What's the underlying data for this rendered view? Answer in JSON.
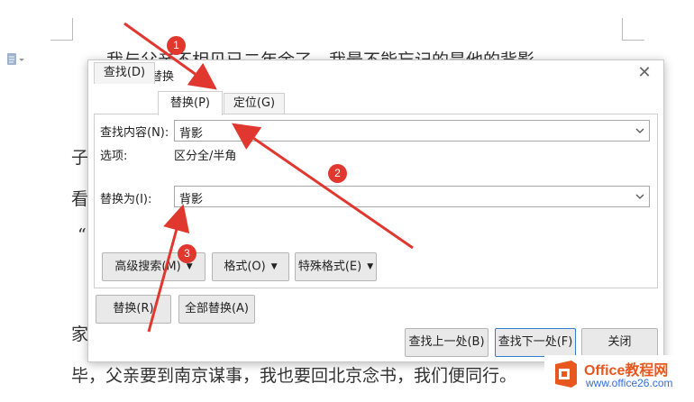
{
  "document": {
    "lines": [
      "我与父亲不相见已二年余了，我最不能忘记的是他的背影。",
      "子",
      "看",
      "“",
      "家",
      "毕，父亲要到南京谋事，我也要回北京念书，我们便同行。"
    ]
  },
  "dialog": {
    "title": "查找和替换",
    "tabs": [
      "查找(D)",
      "替换(P)",
      "定位(G)"
    ],
    "active_tab": "替换(P)",
    "find_label": "查找内容(N):",
    "find_value": "背影",
    "options_label": "选项:",
    "options_value": "区分全/半角",
    "replace_label": "替换为(I):",
    "replace_value": "背影",
    "advanced_search": "高级搜索(M)",
    "format": "格式(O)",
    "special_format": "特殊格式(E)",
    "replace_btn": "替换(R)",
    "replace_all_btn": "全部替换(A)",
    "find_prev_btn": "查找上一处(B)",
    "find_next_btn": "查找下一处(F)",
    "close_btn": "关闭"
  },
  "annotations": {
    "badges": [
      "1",
      "2",
      "3"
    ],
    "color": "#e0382f"
  },
  "watermark": {
    "name": "Office教程网",
    "url": "www.office26.com"
  }
}
